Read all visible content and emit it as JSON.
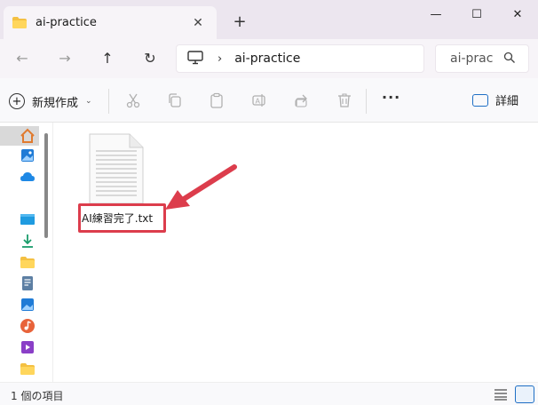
{
  "window": {
    "tab_title": "ai-practice",
    "tab_close": "✕",
    "new_tab": "+",
    "minimize": "—",
    "maximize": "☐",
    "close": "✕"
  },
  "address": {
    "back": "←",
    "forward": "→",
    "up": "↑",
    "refresh": "↻",
    "separator": "›",
    "path": "ai-practice",
    "search_placeholder": "ai-prac"
  },
  "toolbar": {
    "new_label": "新規作成",
    "new_chevron": "⌄",
    "more": "···",
    "details_label": "詳細"
  },
  "content": {
    "file_name": "AI練習完了.txt"
  },
  "status": {
    "item_count": "1 個の項目"
  },
  "colors": {
    "accent": "#1f6fc5",
    "highlight": "#dc3d4c",
    "folder": "#f4c042"
  }
}
